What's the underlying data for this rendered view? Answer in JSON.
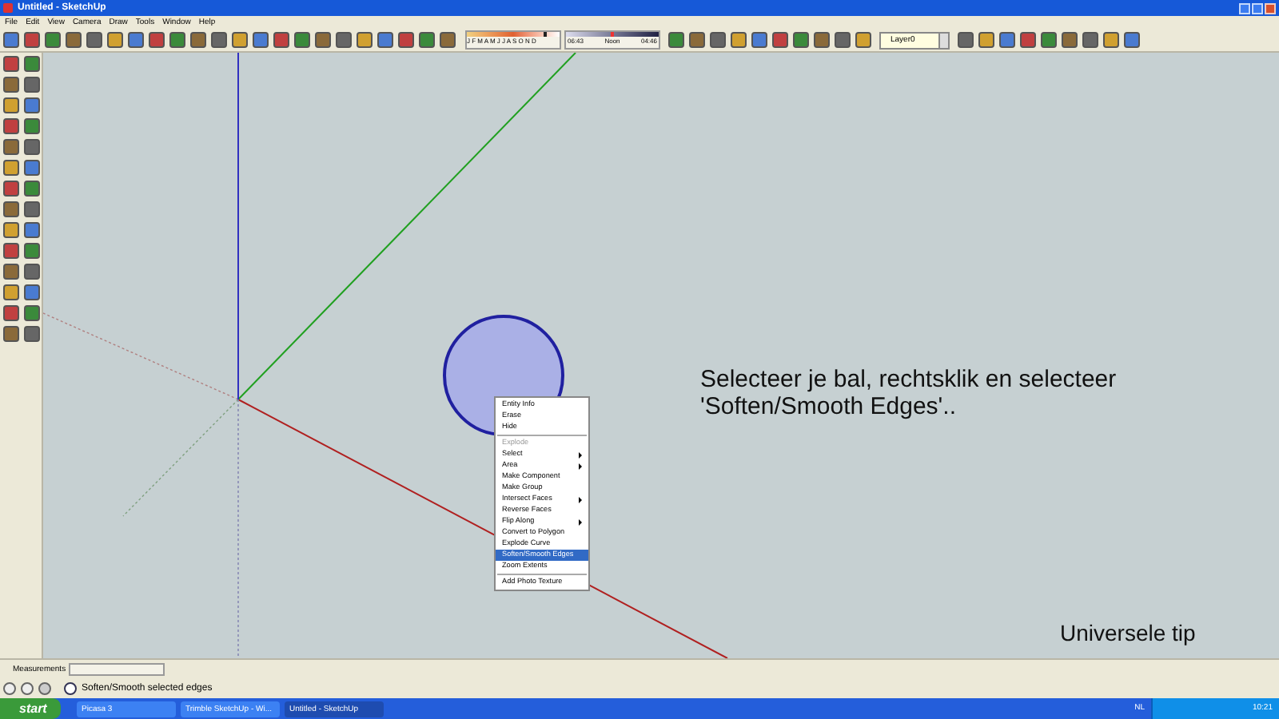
{
  "window": {
    "title": "Untitled - SketchUp"
  },
  "menu_bar": [
    "File",
    "Edit",
    "View",
    "Camera",
    "Draw",
    "Tools",
    "Window",
    "Help"
  ],
  "shadow_toolbar": {
    "date_slider": {
      "level": 0.85
    },
    "time_slider": {
      "level": 0.5
    },
    "months": "J F M A M J J A S O N D",
    "time_start": "06:43",
    "time_mid": "Noon",
    "time_end": "04:46"
  },
  "layer_dropdown": {
    "value": "Layer0"
  },
  "context_menu": {
    "groups": [
      [
        {
          "label": "Entity Info",
          "disabled": false,
          "submenu": false,
          "selected": false
        },
        {
          "label": "Erase",
          "disabled": false,
          "submenu": false,
          "selected": false
        },
        {
          "label": "Hide",
          "disabled": false,
          "submenu": false,
          "selected": false
        }
      ],
      [
        {
          "label": "Explode",
          "disabled": true,
          "submenu": false,
          "selected": false
        },
        {
          "label": "Select",
          "disabled": false,
          "submenu": true,
          "selected": false
        },
        {
          "label": "Area",
          "disabled": false,
          "submenu": true,
          "selected": false
        },
        {
          "label": "Make Component",
          "disabled": false,
          "submenu": false,
          "selected": false
        },
        {
          "label": "Make Group",
          "disabled": false,
          "submenu": false,
          "selected": false
        },
        {
          "label": "Intersect Faces",
          "disabled": false,
          "submenu": true,
          "selected": false
        },
        {
          "label": "Reverse Faces",
          "disabled": false,
          "submenu": false,
          "selected": false
        },
        {
          "label": "Flip Along",
          "disabled": false,
          "submenu": true,
          "selected": false
        },
        {
          "label": "Convert to Polygon",
          "disabled": false,
          "submenu": false,
          "selected": false
        },
        {
          "label": "Explode Curve",
          "disabled": false,
          "submenu": false,
          "selected": false
        },
        {
          "label": "Soften/Smooth Edges",
          "disabled": false,
          "submenu": false,
          "selected": true
        },
        {
          "label": "Zoom Extents",
          "disabled": false,
          "submenu": false,
          "selected": false
        }
      ],
      [
        {
          "label": "Add Photo Texture",
          "disabled": false,
          "submenu": false,
          "selected": false
        }
      ]
    ]
  },
  "annotation": {
    "lines": [
      "Selecteer je bal, rechtsklik en selecteer",
      "'Soften/Smooth Edges'.."
    ],
    "tip": "Universele tip"
  },
  "measurements": {
    "label": "Measurements"
  },
  "status_bar": {
    "text": "Soften/Smooth selected edges"
  },
  "taskbar": {
    "start": "start",
    "tasks": [
      {
        "label": "Picasa 3",
        "selected": false
      },
      {
        "label": "Trimble SketchUp - Wi...",
        "selected": false
      },
      {
        "label": "Untitled - SketchUp",
        "selected": true
      }
    ],
    "language": "NL",
    "clock": "10:21"
  }
}
